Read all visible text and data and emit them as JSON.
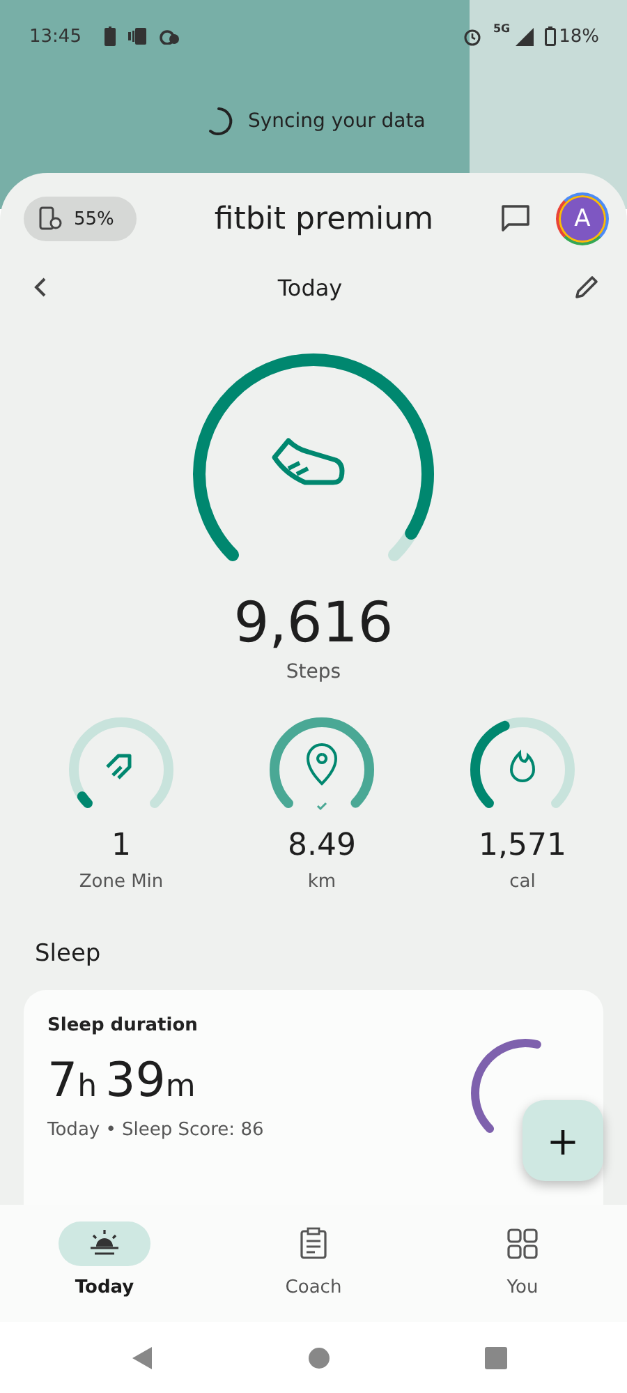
{
  "status_bar": {
    "time": "13:45",
    "network": "5G",
    "battery": "18%"
  },
  "sync_banner": {
    "text": "Syncing your data"
  },
  "header": {
    "device_battery": "55%",
    "title": "fitbit premium",
    "avatar": "A"
  },
  "date_nav": {
    "title": "Today"
  },
  "steps": {
    "value": "9,616",
    "label": "Steps"
  },
  "stats": [
    {
      "value": "1",
      "label": "Zone Min",
      "goal_met": false
    },
    {
      "value": "8.49",
      "label": "km",
      "goal_met": true
    },
    {
      "value": "1,571",
      "label": "cal",
      "goal_met": false
    }
  ],
  "sleep": {
    "section": "Sleep",
    "card_title": "Sleep duration",
    "hours": "7",
    "hours_unit": "h",
    "minutes": "39",
    "minutes_unit": "m",
    "summary": "Today • Sleep Score: 86"
  },
  "fab": {
    "label": "+"
  },
  "tabs": [
    {
      "label": "Today",
      "selected": true
    },
    {
      "label": "Coach",
      "selected": false
    },
    {
      "label": "You",
      "selected": false
    }
  ]
}
